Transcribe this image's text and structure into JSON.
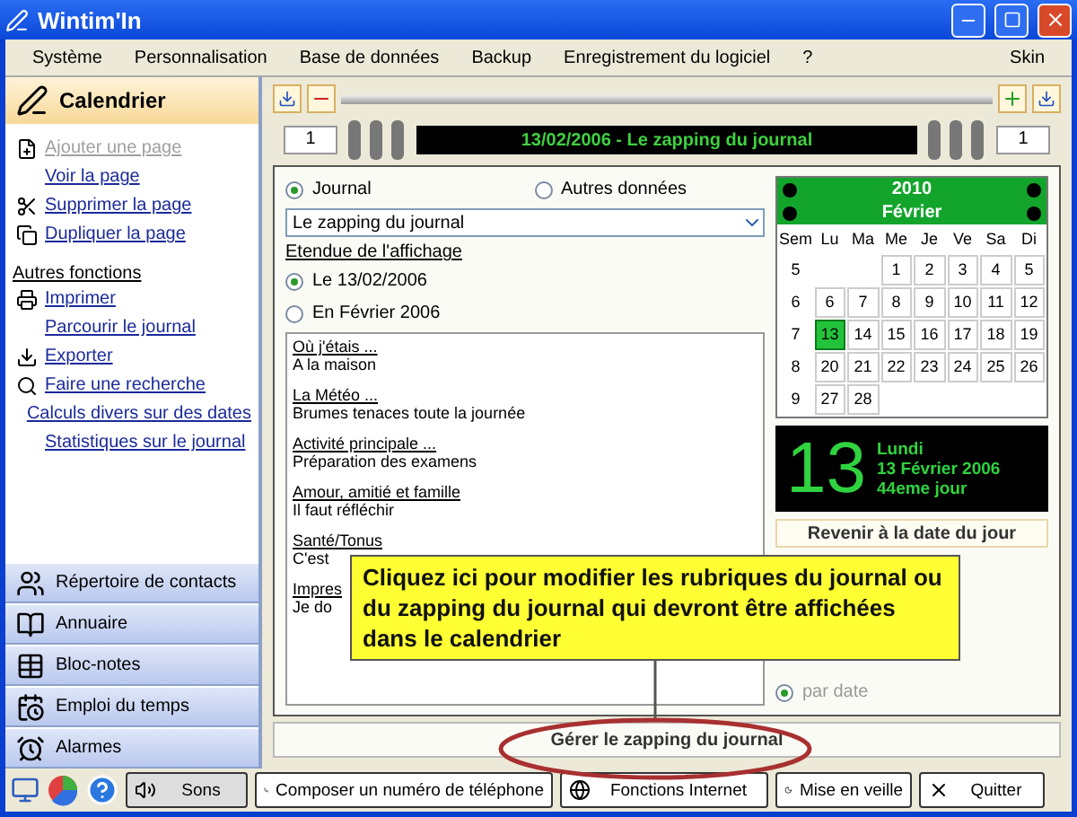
{
  "window": {
    "title": "Wintim'In"
  },
  "menu": [
    "Système",
    "Personnalisation",
    "Base de données",
    "Backup",
    "Enregistrement du logiciel",
    "?"
  ],
  "menu_right": "Skin",
  "sidebar": {
    "title": "Calendrier",
    "links": [
      {
        "label": "Ajouter une page",
        "disabled": true
      },
      {
        "label": "Voir la page",
        "disabled": false
      },
      {
        "label": "Supprimer la page",
        "disabled": false
      },
      {
        "label": "Dupliquer la page",
        "disabled": false
      }
    ],
    "section": "Autres fonctions",
    "links2": [
      {
        "label": "Imprimer"
      },
      {
        "label": "Parcourir le journal"
      },
      {
        "label": "Exporter"
      },
      {
        "label": "Faire une recherche"
      },
      {
        "label": "Calculs divers sur des dates"
      },
      {
        "label": "Statistiques sur le journal"
      }
    ],
    "nav": [
      "Répertoire de contacts",
      "Annuaire",
      "Bloc-notes",
      "Emploi du temps",
      "Alarmes"
    ]
  },
  "page": {
    "left_number": "1",
    "title": "13/02/2006 - Le zapping du journal",
    "right_number": "1"
  },
  "source": [
    {
      "label": "Journal",
      "selected": true
    },
    {
      "label": "Autres données",
      "selected": false
    }
  ],
  "dropdown": {
    "value": "Le zapping du journal"
  },
  "range": {
    "label": "Etendue de l'affichage",
    "options": [
      {
        "label": "Le 13/02/2006",
        "selected": true
      },
      {
        "label": "En Février 2006",
        "selected": false
      }
    ]
  },
  "entries": [
    {
      "heading": "Où j'étais ...",
      "text": "A la maison"
    },
    {
      "heading": "La Météo ...",
      "text": "Brumes tenaces toute la journée"
    },
    {
      "heading": "Activité principale ...",
      "text": "Préparation des examens"
    },
    {
      "heading": "Amour, amitié et famille",
      "text": "Il faut réfléchir"
    },
    {
      "heading": "Santé/Tonus",
      "text": "C'est"
    },
    {
      "heading": "Impres",
      "text": "Je do"
    }
  ],
  "calendar": {
    "year": "2010",
    "month": "Février",
    "headers": [
      "Sem",
      "Lu",
      "Ma",
      "Me",
      "Je",
      "Ve",
      "Sa",
      "Di"
    ],
    "weeks": [
      {
        "week": "5",
        "days": [
          {
            "day": "1",
            "selected": false
          },
          {
            "day": "2",
            "selected": false
          },
          {
            "day": "3",
            "selected": false
          },
          {
            "day": "4",
            "selected": false
          },
          {
            "day": "5",
            "selected": false
          }
        ]
      },
      {
        "week": "6",
        "days": [
          {
            "day": "6",
            "selected": false
          },
          {
            "day": "7",
            "selected": false
          },
          {
            "day": "8",
            "selected": false
          },
          {
            "day": "9",
            "selected": false
          },
          {
            "day": "10",
            "selected": false
          },
          {
            "day": "11",
            "selected": false
          },
          {
            "day": "12",
            "selected": false
          }
        ]
      },
      {
        "week": "7",
        "days": [
          {
            "day": "13",
            "selected": true
          },
          {
            "day": "14",
            "selected": false
          },
          {
            "day": "15",
            "selected": false
          },
          {
            "day": "16",
            "selected": false
          },
          {
            "day": "17",
            "selected": false
          },
          {
            "day": "18",
            "selected": false
          },
          {
            "day": "19",
            "selected": false
          }
        ]
      },
      {
        "week": "8",
        "days": [
          {
            "day": "20",
            "selected": false
          },
          {
            "day": "21",
            "selected": false
          },
          {
            "day": "22",
            "selected": false
          },
          {
            "day": "23",
            "selected": false
          },
          {
            "day": "24",
            "selected": false
          },
          {
            "day": "25",
            "selected": false
          },
          {
            "day": "26",
            "selected": false
          }
        ]
      },
      {
        "week": "9",
        "days": [
          {
            "day": "27",
            "selected": false
          },
          {
            "day": "28",
            "selected": false
          }
        ]
      }
    ]
  },
  "today": {
    "day": "13",
    "weekday": "Lundi",
    "date": "13 Février 2006",
    "ordinal": "44eme jour"
  },
  "today_button": "Revenir à la date du jour",
  "sort": {
    "label": "par date",
    "selected": true
  },
  "manage_button": "Gérer le zapping du journal",
  "tooltip": "Cliquez ici pour modifier les rubriques du journal ou du zapping du journal qui devront être affichées dans le calendrier",
  "taskbar": {
    "sound": "Sons",
    "buttons": [
      "Composer un numéro de téléphone",
      "Fonctions Internet",
      "Mise en veille",
      "Quitter"
    ]
  }
}
